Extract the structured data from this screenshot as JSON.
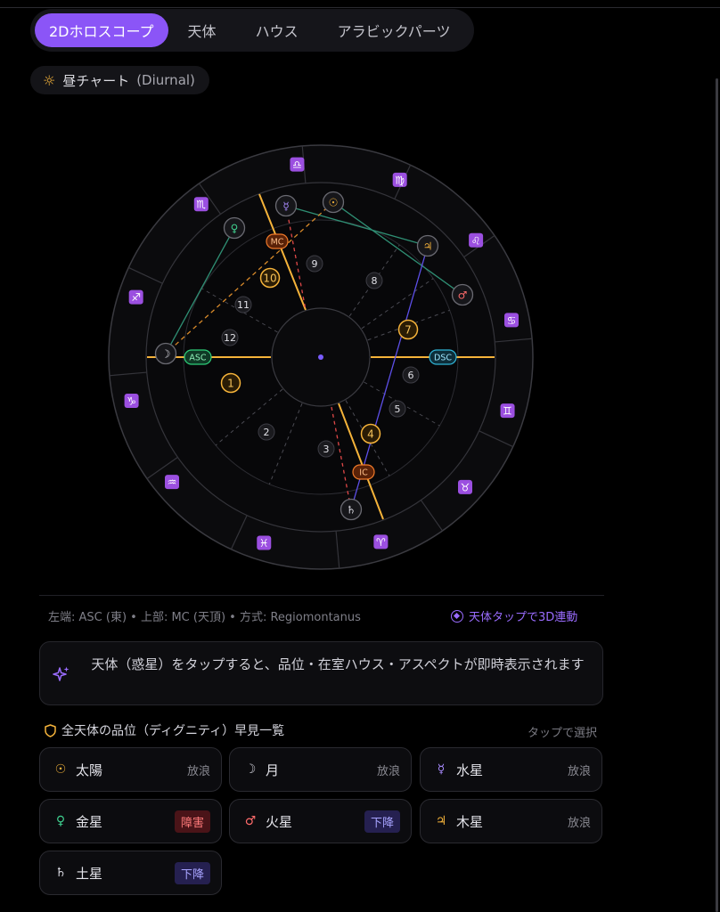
{
  "tabs": [
    "2Dホロスコープ",
    "天体",
    "ハウス",
    "アラビックパーツ"
  ],
  "chart_type_chip": {
    "icon": "☼",
    "label": "昼チャート",
    "sub": "(Diurnal)"
  },
  "wheel": {
    "angles": {
      "asc": "ASC",
      "dsc": "DSC",
      "mc": "MC",
      "ic": "IC"
    },
    "houses": [
      "1",
      "2",
      "3",
      "4",
      "5",
      "6",
      "7",
      "8",
      "9",
      "10",
      "11",
      "12"
    ],
    "signs": [
      "♎",
      "♍",
      "♌",
      "♋",
      "♊",
      "♉",
      "♈",
      "♓",
      "♒",
      "♑",
      "♐",
      "♏"
    ],
    "planets": [
      {
        "glyph": "☉",
        "name": "sun",
        "color": "#f5b33a"
      },
      {
        "glyph": "☿",
        "name": "mercury",
        "color": "#a98bff"
      },
      {
        "glyph": "♀",
        "name": "venus",
        "color": "#3fcf8e"
      },
      {
        "glyph": "♃",
        "name": "jupiter",
        "color": "#f5b33a"
      },
      {
        "glyph": "♂",
        "name": "mars",
        "color": "#ff6b6b"
      },
      {
        "glyph": "☽",
        "name": "moon",
        "color": "#d8d8e0"
      },
      {
        "glyph": "♄",
        "name": "saturn",
        "color": "#d8d8e0"
      }
    ]
  },
  "info": {
    "left": "左端: ASC (東) • 上部: MC (天頂) • 方式: Regiomontanus",
    "link": "天体タップで3D連動"
  },
  "hint": "天体（惑星）をタップすると、品位・在室ハウス・アスペクトが即時表示されます",
  "dignity": {
    "title": "全天体の品位（ディグニティ）早見一覧",
    "select": "タップで選択",
    "items": [
      {
        "glyph": "☉",
        "color": "#f5b33a",
        "name": "太陽",
        "status": "放浪",
        "kind": "normal"
      },
      {
        "glyph": "☽",
        "color": "#c8c8d0",
        "name": "月",
        "status": "放浪",
        "kind": "normal"
      },
      {
        "glyph": "☿",
        "color": "#a98bff",
        "name": "水星",
        "status": "放浪",
        "kind": "normal"
      },
      {
        "glyph": "♀",
        "color": "#3fcf8e",
        "name": "金星",
        "status": "障害",
        "kind": "bad"
      },
      {
        "glyph": "♂",
        "color": "#ff6b6b",
        "name": "火星",
        "status": "下降",
        "kind": "fall"
      },
      {
        "glyph": "♃",
        "color": "#f5b33a",
        "name": "木星",
        "status": "放浪",
        "kind": "normal"
      },
      {
        "glyph": "♄",
        "color": "#d8d8e0",
        "name": "土星",
        "status": "下降",
        "kind": "fall"
      }
    ]
  }
}
